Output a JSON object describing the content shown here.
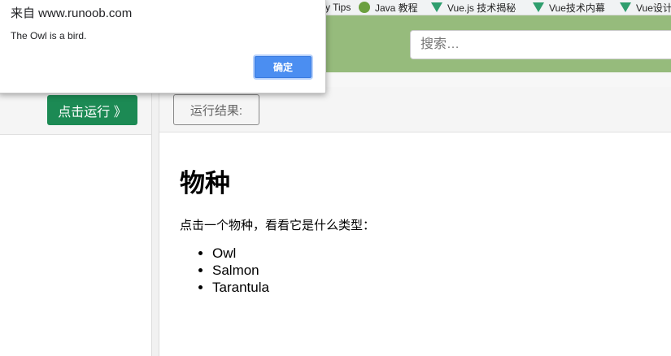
{
  "bookmarks": [
    {
      "icon": "none",
      "label": "y Tips"
    },
    {
      "icon": "java-icon",
      "label": "Java 教程"
    },
    {
      "icon": "vue-icon",
      "label": "Vue.js 技术揭秘"
    },
    {
      "icon": "vue-icon",
      "label": "Vue技术内幕"
    },
    {
      "icon": "vue-icon",
      "label": "Vue设计"
    }
  ],
  "header": {
    "search_placeholder": "搜索…",
    "color": "#96bb7c"
  },
  "editor": {
    "run_label": "点击运行 》",
    "run_color": "#1c8a54"
  },
  "result": {
    "label": "运行结果:",
    "heading": "物种",
    "intro": "点击一个物种，看看它是什么类型：",
    "species": [
      "Owl",
      "Salmon",
      "Tarantula"
    ]
  },
  "dialog": {
    "origin": "来自 www.runoob.com",
    "message": "The Owl is a bird.",
    "ok_label": "确定"
  }
}
